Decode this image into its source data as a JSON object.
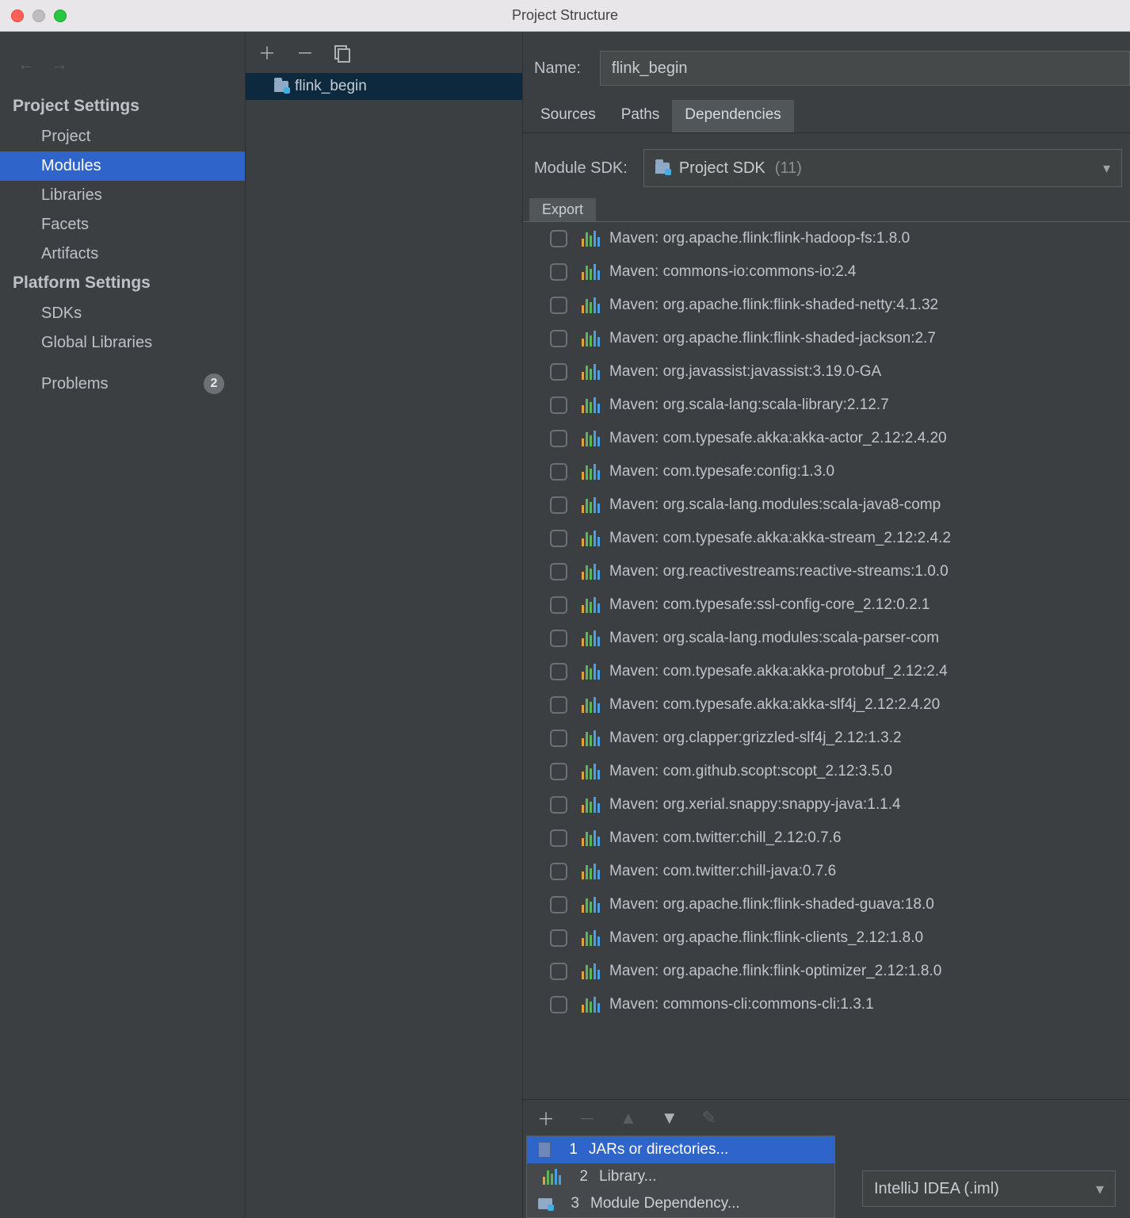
{
  "window_title": "Project Structure",
  "sidebar": {
    "heading1": "Project Settings",
    "items1": [
      "Project",
      "Modules",
      "Libraries",
      "Facets",
      "Artifacts"
    ],
    "active1": "Modules",
    "heading2": "Platform Settings",
    "items2": [
      "SDKs",
      "Global Libraries"
    ],
    "problems_label": "Problems",
    "problems_count": "2"
  },
  "tree": {
    "selected": "flink_begin"
  },
  "name_label": "Name:",
  "name_value": "flink_begin",
  "tabs": [
    "Sources",
    "Paths",
    "Dependencies"
  ],
  "active_tab": "Dependencies",
  "sdk_label": "Module SDK:",
  "sdk_value": "Project SDK",
  "sdk_version": "(11)",
  "export_label": "Export",
  "dependencies": [
    "Maven: org.apache.flink:flink-hadoop-fs:1.8.0",
    "Maven: commons-io:commons-io:2.4",
    "Maven: org.apache.flink:flink-shaded-netty:4.1.32",
    "Maven: org.apache.flink:flink-shaded-jackson:2.7",
    "Maven: org.javassist:javassist:3.19.0-GA",
    "Maven: org.scala-lang:scala-library:2.12.7",
    "Maven: com.typesafe.akka:akka-actor_2.12:2.4.20",
    "Maven: com.typesafe:config:1.3.0",
    "Maven: org.scala-lang.modules:scala-java8-comp",
    "Maven: com.typesafe.akka:akka-stream_2.12:2.4.2",
    "Maven: org.reactivestreams:reactive-streams:1.0.0",
    "Maven: com.typesafe:ssl-config-core_2.12:0.2.1",
    "Maven: org.scala-lang.modules:scala-parser-com",
    "Maven: com.typesafe.akka:akka-protobuf_2.12:2.4",
    "Maven: com.typesafe.akka:akka-slf4j_2.12:2.4.20",
    "Maven: org.clapper:grizzled-slf4j_2.12:1.3.2",
    "Maven: com.github.scopt:scopt_2.12:3.5.0",
    "Maven: org.xerial.snappy:snappy-java:1.1.4",
    "Maven: com.twitter:chill_2.12:0.7.6",
    "Maven: com.twitter:chill-java:0.7.6",
    "Maven: org.apache.flink:flink-shaded-guava:18.0",
    "Maven: org.apache.flink:flink-clients_2.12:1.8.0",
    "Maven: org.apache.flink:flink-optimizer_2.12:1.8.0",
    "Maven: commons-cli:commons-cli:1.3.1"
  ],
  "popup": {
    "items": [
      {
        "num": "1",
        "label": "JARs or directories..."
      },
      {
        "num": "2",
        "label": "Library..."
      },
      {
        "num": "3",
        "label": "Module Dependency..."
      }
    ],
    "active": 0
  },
  "format_select": "IntelliJ IDEA (.iml)"
}
